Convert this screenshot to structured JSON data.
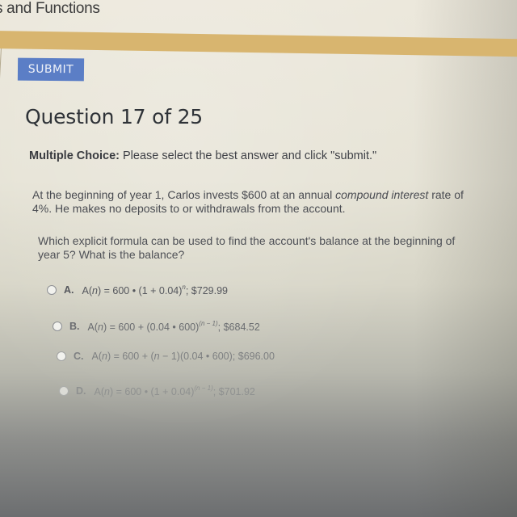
{
  "header": {
    "title_fragment": "s and Functions"
  },
  "toolbar": {
    "submit_label": "SUBMIT"
  },
  "colors": {
    "accent_bar": "#d8b56f",
    "submit_button": "#5b7ec6"
  },
  "question": {
    "title": "Question 17 of 25",
    "instructions_lead": "Multiple Choice:",
    "instructions_text": " Please select the best answer and click \"submit.\"",
    "stem_part1": "At the beginning of year 1, Carlos invests $600 at an annual ",
    "stem_italic": "compound interest",
    "stem_part2": " rate of 4%. He makes no deposits to or withdrawals from the account.",
    "prompt": "Which explicit formula can be used to find the account's balance at the beginning of year 5? What is the balance?"
  },
  "choices": [
    {
      "letter": "A.",
      "formula_prefix": "A(",
      "var": "n",
      "formula_mid": ") = 600 • (1 + 0.04)",
      "exponent": "n",
      "answer": "; $729.99",
      "selected": false
    },
    {
      "letter": "B.",
      "formula_prefix": "A(",
      "var": "n",
      "formula_mid": ") = 600 + (0.04 • 600)",
      "exponent": "(n − 1)",
      "answer": "; $684.52",
      "selected": false
    },
    {
      "letter": "C.",
      "formula_prefix": "A(",
      "var": "n",
      "formula_mid": ") = 600 + (",
      "var2": "n",
      "formula_end": " − 1)(0.04 • 600)",
      "answer": "; $696.00",
      "selected": false
    },
    {
      "letter": "D.",
      "formula_prefix": "A(",
      "var": "n",
      "formula_mid": ") = 600 • (1 + 0.04)",
      "exponent": "(n − 1)",
      "answer": "; $701.92",
      "selected": false
    }
  ]
}
